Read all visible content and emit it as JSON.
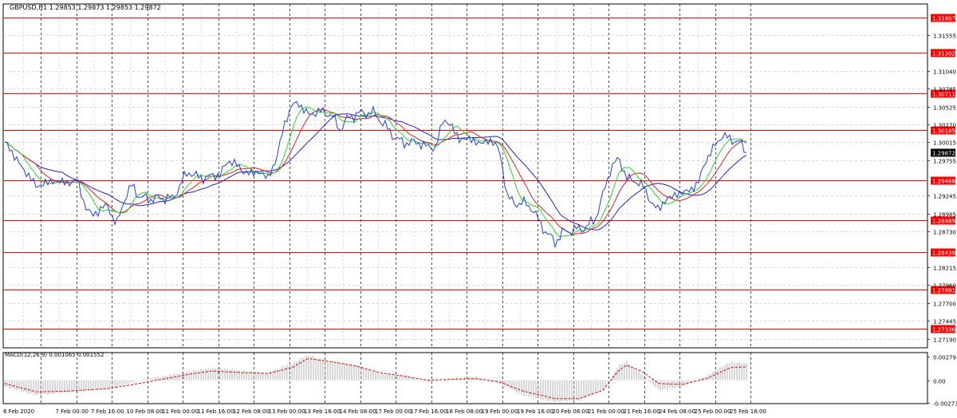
{
  "main_chart": {
    "title": "GBPUSD,H1  1.29853 1.29873 1.29853 1.29872",
    "price_scale": {
      "min": 1.2706,
      "max": 1.32,
      "ticks": [
        "1.31555",
        "1.31040",
        "1.30785",
        "1.30525",
        "1.30270",
        "1.30015",
        "1.29755",
        "1.29245",
        "1.28985",
        "1.28730",
        "1.28215",
        "1.27960",
        "1.27700",
        "1.27445",
        "1.27190"
      ]
    },
    "current_price": {
      "label": "1.29872",
      "value": 1.29872
    },
    "support_resistance": [
      {
        "label": "1.31807",
        "value": 1.31807
      },
      {
        "label": "1.31302",
        "value": 1.31302
      },
      {
        "label": "1.30711",
        "value": 1.30711
      },
      {
        "label": "1.30185",
        "value": 1.30185
      },
      {
        "label": "1.29468",
        "value": 1.29468
      },
      {
        "label": "1.28889",
        "value": 1.28889
      },
      {
        "label": "1.28439",
        "value": 1.28439
      },
      {
        "label": "1.27891",
        "value": 1.27891
      },
      {
        "label": "1.27336",
        "value": 1.27336
      }
    ]
  },
  "macd_panel": {
    "title": "MACD(12,26,9) 0.001065 0.001552",
    "scale": {
      "min": -0.0028,
      "max": 0.0033,
      "ticks": [
        "0.00279",
        "0.00",
        "-0.002739"
      ]
    }
  },
  "time_axis": [
    "6 Feb 2020",
    "7 Feb 00:00",
    "7 Feb 16:00",
    "10 Feb 08:00",
    "11 Feb 00:00",
    "11 Feb 16:00",
    "12 Feb 08:00",
    "13 Feb 00:00",
    "13 Feb 16:00",
    "14 Feb 08:00",
    "17 Feb 00:00",
    "17 Feb 16:00",
    "18 Feb 08:00",
    "19 Feb 00:00",
    "19 Feb 16:00",
    "20 Feb 08:00",
    "21 Feb 00:00",
    "21 Feb 16:00",
    "24 Feb 08:00",
    "25 Feb 00:00",
    "25 Feb 16:00"
  ],
  "colors": {
    "price_line": "#1f3fe0",
    "ma_fast": "#2fd02f",
    "ma_mid": "#e02020",
    "ma_slow": "#2020d0",
    "level_line": "#ff0000",
    "label_bg": "#ff0000",
    "current_bg": "#000000",
    "grid": "#b4b4b4",
    "macd_hist": "#b0b0b0",
    "macd_signal": "#e00000"
  },
  "chart_data": {
    "type": "line",
    "title": "GBPUSD,H1",
    "x": [
      "6 Feb 2020",
      "7 Feb 00:00",
      "7 Feb 16:00",
      "10 Feb 08:00",
      "11 Feb 00:00",
      "11 Feb 16:00",
      "12 Feb 08:00",
      "13 Feb 00:00",
      "13 Feb 16:00",
      "14 Feb 08:00",
      "17 Feb 00:00",
      "17 Feb 16:00",
      "18 Feb 08:00",
      "19 Feb 00:00",
      "19 Feb 16:00",
      "20 Feb 08:00",
      "21 Feb 00:00",
      "21 Feb 16:00",
      "24 Feb 08:00",
      "25 Feb 00:00",
      "25 Feb 16:00"
    ],
    "price_points": [
      [
        0,
        1.2999
      ],
      [
        10,
        1.2987
      ],
      [
        20,
        1.2966
      ],
      [
        30,
        1.2954
      ],
      [
        40,
        1.2937
      ],
      [
        50,
        1.2943
      ],
      [
        60,
        1.2945
      ],
      [
        70,
        1.2946
      ],
      [
        80,
        1.2941
      ],
      [
        90,
        1.2949
      ],
      [
        100,
        1.2912
      ],
      [
        110,
        1.2895
      ],
      [
        120,
        1.2906
      ],
      [
        130,
        1.291
      ],
      [
        140,
        1.2881
      ],
      [
        150,
        1.292
      ],
      [
        160,
        1.294
      ],
      [
        170,
        1.2921
      ],
      [
        180,
        1.2921
      ],
      [
        190,
        1.292
      ],
      [
        200,
        1.2922
      ],
      [
        210,
        1.292
      ],
      [
        220,
        1.294
      ],
      [
        230,
        1.296
      ],
      [
        240,
        1.2952
      ],
      [
        250,
        1.295
      ],
      [
        260,
        1.2953
      ],
      [
        270,
        1.2955
      ],
      [
        280,
        1.2975
      ],
      [
        290,
        1.297
      ],
      [
        300,
        1.2958
      ],
      [
        310,
        1.2957
      ],
      [
        320,
        1.2958
      ],
      [
        330,
        1.295
      ],
      [
        340,
        1.2975
      ],
      [
        350,
        1.3025
      ],
      [
        360,
        1.3055
      ],
      [
        370,
        1.3057
      ],
      [
        380,
        1.304
      ],
      [
        390,
        1.3045
      ],
      [
        400,
        1.3045
      ],
      [
        410,
        1.304
      ],
      [
        420,
        1.302
      ],
      [
        430,
        1.3035
      ],
      [
        440,
        1.3042
      ],
      [
        450,
        1.3043
      ],
      [
        460,
        1.3045
      ],
      [
        470,
        1.3035
      ],
      [
        480,
        1.302
      ],
      [
        490,
        1.3008
      ],
      [
        500,
        1.3
      ],
      [
        510,
        1.3002
      ],
      [
        520,
        1.3
      ],
      [
        530,
        1.2995
      ],
      [
        540,
        1.2993
      ],
      [
        550,
        1.3035
      ],
      [
        560,
        1.3025
      ],
      [
        570,
        1.3005
      ],
      [
        580,
        1.3007
      ],
      [
        590,
        1.3002
      ],
      [
        600,
        1.3
      ],
      [
        610,
        1.3005
      ],
      [
        620,
        1.299
      ],
      [
        630,
        1.2925
      ],
      [
        640,
        1.2912
      ],
      [
        650,
        1.2915
      ],
      [
        660,
        1.2908
      ],
      [
        670,
        1.2888
      ],
      [
        680,
        1.287
      ],
      [
        690,
        1.2858
      ],
      [
        700,
        1.2872
      ],
      [
        710,
        1.2875
      ],
      [
        720,
        1.2876
      ],
      [
        730,
        1.288
      ],
      [
        740,
        1.289
      ],
      [
        750,
        1.2925
      ],
      [
        760,
        1.2965
      ],
      [
        770,
        1.2978
      ],
      [
        780,
        1.295
      ],
      [
        790,
        1.2945
      ],
      [
        800,
        1.294
      ],
      [
        810,
        1.2915
      ],
      [
        820,
        1.2905
      ],
      [
        830,
        1.292
      ],
      [
        840,
        1.2925
      ],
      [
        850,
        1.293
      ],
      [
        860,
        1.2932
      ],
      [
        870,
        1.2945
      ],
      [
        880,
        1.2978
      ],
      [
        890,
        1.2995
      ],
      [
        900,
        1.3012
      ],
      [
        910,
        1.3005
      ],
      [
        920,
        1.3003
      ],
      [
        930,
        1.2987
      ]
    ],
    "moving_averages": [
      {
        "name": "",
        "color": "#2fd02f",
        "period": 8
      },
      {
        "name": "",
        "color": "#e02020",
        "period": 14
      },
      {
        "name": "",
        "color": "#2020d0",
        "period": 25
      }
    ],
    "macd": {
      "hist_points": [
        [
          0,
          -0.0008
        ],
        [
          40,
          -0.0018
        ],
        [
          80,
          -0.0014
        ],
        [
          130,
          -0.001
        ],
        [
          180,
          0.0002
        ],
        [
          230,
          0.001
        ],
        [
          260,
          0.0015
        ],
        [
          300,
          0.0011
        ],
        [
          330,
          0.0009
        ],
        [
          360,
          0.002
        ],
        [
          380,
          0.003
        ],
        [
          410,
          0.0022
        ],
        [
          440,
          0.0018
        ],
        [
          470,
          0.0008
        ],
        [
          500,
          0.0006
        ],
        [
          530,
          -0.0002
        ],
        [
          560,
          0.0002
        ],
        [
          590,
          0.0004
        ],
        [
          620,
          -0.0004
        ],
        [
          650,
          -0.0018
        ],
        [
          690,
          -0.0026
        ],
        [
          720,
          -0.0024
        ],
        [
          750,
          -0.0012
        ],
        [
          770,
          0.0018
        ],
        [
          780,
          0.0022
        ],
        [
          800,
          0.0006
        ],
        [
          820,
          -0.0012
        ],
        [
          850,
          -0.0008
        ],
        [
          880,
          0.0005
        ],
        [
          910,
          0.0022
        ],
        [
          930,
          0.002
        ]
      ],
      "signal_points": [
        [
          0,
          -0.0004
        ],
        [
          40,
          -0.0014
        ],
        [
          80,
          -0.0013
        ],
        [
          130,
          -0.001
        ],
        [
          180,
          -0.0002
        ],
        [
          230,
          0.0007
        ],
        [
          260,
          0.0011
        ],
        [
          300,
          0.0009
        ],
        [
          330,
          0.0008
        ],
        [
          360,
          0.0015
        ],
        [
          380,
          0.0026
        ],
        [
          410,
          0.0022
        ],
        [
          440,
          0.0017
        ],
        [
          470,
          0.0009
        ],
        [
          500,
          0.0005
        ],
        [
          530,
          0.0
        ],
        [
          560,
          0.0001
        ],
        [
          590,
          0.0002
        ],
        [
          620,
          -0.0002
        ],
        [
          650,
          -0.0013
        ],
        [
          690,
          -0.0022
        ],
        [
          720,
          -0.0022
        ],
        [
          750,
          -0.0012
        ],
        [
          770,
          0.0012
        ],
        [
          780,
          0.0018
        ],
        [
          800,
          0.001
        ],
        [
          820,
          -0.0004
        ],
        [
          850,
          -0.0005
        ],
        [
          880,
          0.0002
        ],
        [
          910,
          0.0015
        ],
        [
          930,
          0.0016
        ]
      ]
    }
  }
}
